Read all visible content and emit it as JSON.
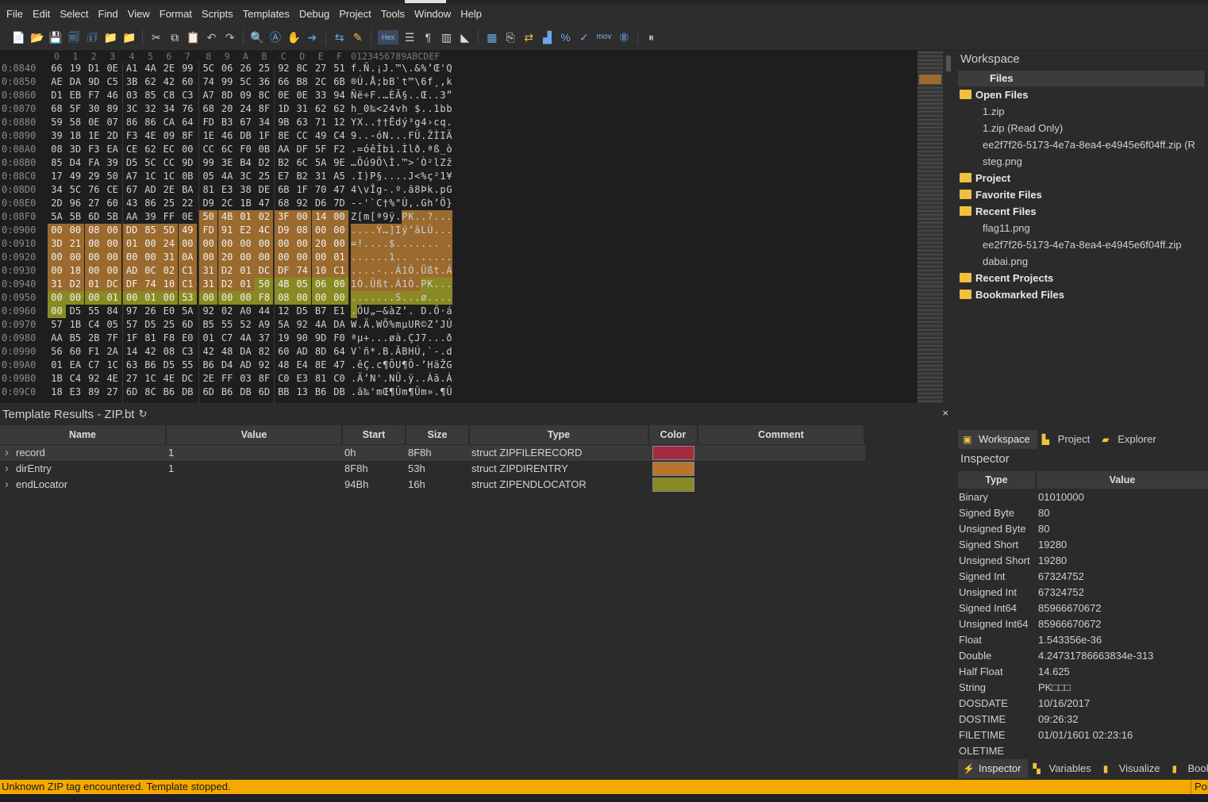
{
  "menu": [
    "File",
    "Edit",
    "Select",
    "Find",
    "View",
    "Format",
    "Scripts",
    "Templates",
    "Debug",
    "Project",
    "Tools",
    "Window",
    "Help"
  ],
  "toolbar": {
    "hex_label": "Hex",
    "mov_label": "mov"
  },
  "hex": {
    "col_headers": [
      "0",
      "1",
      "2",
      "3",
      "4",
      "5",
      "6",
      "7",
      "8",
      "9",
      "A",
      "B",
      "C",
      "D",
      "E",
      "F"
    ],
    "text_header": "0123456789ABCDEF",
    "rows": [
      {
        "addr": "0:0840",
        "bytes": [
          "66",
          "19",
          "D1",
          "0E",
          "A1",
          "4A",
          "2E",
          "99",
          "5C",
          "06",
          "26",
          "25",
          "92",
          "8C",
          "27",
          "51"
        ],
        "text": "f.Ñ.¡J.™\\.&%’Œ'Q"
      },
      {
        "addr": "0:0850",
        "bytes": [
          "AE",
          "DA",
          "9D",
          "C5",
          "3B",
          "62",
          "42",
          "60",
          "74",
          "99",
          "5C",
          "36",
          "66",
          "B8",
          "2C",
          "6B"
        ],
        "text": "®Ú.Å;bB`t™\\6f¸,k"
      },
      {
        "addr": "0:0860",
        "bytes": [
          "D1",
          "EB",
          "F7",
          "46",
          "03",
          "85",
          "C8",
          "C3",
          "A7",
          "8D",
          "09",
          "8C",
          "0E",
          "0E",
          "33",
          "94"
        ],
        "text": "Ñë÷F.…ÈÃ§..Œ..3”"
      },
      {
        "addr": "0:0870",
        "bytes": [
          "68",
          "5F",
          "30",
          "89",
          "3C",
          "32",
          "34",
          "76",
          "68",
          "20",
          "24",
          "8F",
          "1D",
          "31",
          "62",
          "62"
        ],
        "text": "h_0‰<24vh $..1bb"
      },
      {
        "addr": "0:0880",
        "bytes": [
          "59",
          "58",
          "0E",
          "07",
          "86",
          "86",
          "CA",
          "64",
          "FD",
          "B3",
          "67",
          "34",
          "9B",
          "63",
          "71",
          "12"
        ],
        "text": "YX..††Êdý³g4›cq."
      },
      {
        "addr": "0:0890",
        "bytes": [
          "39",
          "18",
          "1E",
          "2D",
          "F3",
          "4E",
          "09",
          "8F",
          "1E",
          "46",
          "DB",
          "1F",
          "8E",
          "CC",
          "49",
          "C4"
        ],
        "text": "9..-óN...FÛ.ŽÌIÄ"
      },
      {
        "addr": "0:08A0",
        "bytes": [
          "08",
          "3D",
          "F3",
          "EA",
          "CE",
          "62",
          "EC",
          "00",
          "CC",
          "6C",
          "F0",
          "0B",
          "AA",
          "DF",
          "5F",
          "F2"
        ],
        "text": ".=óêÎbì.Ìlð.ªß_ò"
      },
      {
        "addr": "0:08B0",
        "bytes": [
          "85",
          "D4",
          "FA",
          "39",
          "D5",
          "5C",
          "CC",
          "9D",
          "99",
          "3E",
          "B4",
          "D2",
          "B2",
          "6C",
          "5A",
          "9E"
        ],
        "text": "…Ôú9Õ\\Ì.™>´Ò²lZž"
      },
      {
        "addr": "0:08C0",
        "bytes": [
          "17",
          "49",
          "29",
          "50",
          "A7",
          "1C",
          "1C",
          "0B",
          "05",
          "4A",
          "3C",
          "25",
          "E7",
          "B2",
          "31",
          "A5"
        ],
        "text": ".I)P§....J<%ç²1¥"
      },
      {
        "addr": "0:08D0",
        "bytes": [
          "34",
          "5C",
          "76",
          "CE",
          "67",
          "AD",
          "2E",
          "BA",
          "81",
          "E3",
          "38",
          "DE",
          "6B",
          "1F",
          "70",
          "47"
        ],
        "text": "4\\vÎg-.º.ã8Þk.pG"
      },
      {
        "addr": "0:08E0",
        "bytes": [
          "2D",
          "96",
          "27",
          "60",
          "43",
          "86",
          "25",
          "22",
          "D9",
          "2C",
          "1B",
          "47",
          "68",
          "92",
          "D6",
          "7D"
        ],
        "text": "--'`C†%\"Ù,.Gh’Ö}"
      },
      {
        "addr": "0:08F0",
        "bytes": [
          "5A",
          "5B",
          "6D",
          "5B",
          "AA",
          "39",
          "FF",
          "0E",
          "50",
          "4B",
          "01",
          "02",
          "3F",
          "00",
          "14",
          "00"
        ],
        "text": "Z[m[ª9ÿ.PK..?..."
      },
      {
        "addr": "0:0900",
        "bytes": [
          "00",
          "00",
          "08",
          "00",
          "DD",
          "85",
          "5D",
          "49",
          "FD",
          "91",
          "E2",
          "4C",
          "D9",
          "08",
          "00",
          "00"
        ],
        "text": "....Ý…]Iý‘âLÙ..."
      },
      {
        "addr": "0:0910",
        "bytes": [
          "3D",
          "21",
          "00",
          "00",
          "01",
          "00",
          "24",
          "00",
          "00",
          "00",
          "00",
          "00",
          "00",
          "00",
          "20",
          "00"
        ],
        "text": "=!....$....... ."
      },
      {
        "addr": "0:0920",
        "bytes": [
          "00",
          "00",
          "00",
          "00",
          "00",
          "00",
          "31",
          "0A",
          "00",
          "20",
          "00",
          "00",
          "00",
          "00",
          "00",
          "01"
        ],
        "text": "......1.. ......"
      },
      {
        "addr": "0:0930",
        "bytes": [
          "00",
          "18",
          "00",
          "00",
          "AD",
          "0C",
          "02",
          "C1",
          "31",
          "D2",
          "01",
          "DC",
          "DF",
          "74",
          "10",
          "C1"
        ],
        "text": "....-..Á1Ò.Üßt.Á"
      },
      {
        "addr": "0:0940",
        "bytes": [
          "31",
          "D2",
          "01",
          "DC",
          "DF",
          "74",
          "10",
          "C1",
          "31",
          "D2",
          "01",
          "50",
          "4B",
          "05",
          "06",
          "00"
        ],
        "text": "1Ò.Üßt.Á1Ò.PK..."
      },
      {
        "addr": "0:0950",
        "bytes": [
          "00",
          "00",
          "00",
          "01",
          "00",
          "01",
          "00",
          "53",
          "00",
          "00",
          "00",
          "F8",
          "08",
          "00",
          "00",
          "00"
        ],
        "text": ".......S...ø...."
      },
      {
        "addr": "0:0960",
        "bytes": [
          "00",
          "D5",
          "55",
          "84",
          "97",
          "26",
          "E0",
          "5A",
          "92",
          "02",
          "A0",
          "44",
          "12",
          "D5",
          "B7",
          "E1"
        ],
        "text": ".ÕU„—&àZ’. D.Õ·á"
      },
      {
        "addr": "0:0970",
        "bytes": [
          "57",
          "1B",
          "C4",
          "05",
          "57",
          "D5",
          "25",
          "6D",
          "B5",
          "55",
          "52",
          "A9",
          "5A",
          "92",
          "4A",
          "DA"
        ],
        "text": "W.Ä.WÕ%mµUR©Z’JÚ"
      },
      {
        "addr": "0:0980",
        "bytes": [
          "AA",
          "B5",
          "2B",
          "7F",
          "1F",
          "81",
          "F8",
          "E0",
          "01",
          "C7",
          "4A",
          "37",
          "19",
          "90",
          "9D",
          "F0"
        ],
        "text": "ªµ+...øà.ÇJ7...ð"
      },
      {
        "addr": "0:0990",
        "bytes": [
          "56",
          "60",
          "F1",
          "2A",
          "14",
          "42",
          "08",
          "C3",
          "42",
          "48",
          "DA",
          "82",
          "60",
          "AD",
          "8D",
          "64"
        ],
        "text": "V`ñ*.B.ÃBHÚ‚`-.d"
      },
      {
        "addr": "0:09A0",
        "bytes": [
          "01",
          "EA",
          "C7",
          "1C",
          "63",
          "B6",
          "D5",
          "55",
          "B6",
          "D4",
          "AD",
          "92",
          "48",
          "E4",
          "8E",
          "47"
        ],
        "text": ".êÇ.c¶ÕU¶Ô-’HäŽG"
      },
      {
        "addr": "0:09B0",
        "bytes": [
          "1B",
          "C4",
          "92",
          "4E",
          "27",
          "1C",
          "4E",
          "DC",
          "2E",
          "FF",
          "03",
          "8F",
          "C0",
          "E3",
          "81",
          "C0"
        ],
        "text": ".Ä’N'.NÜ.ÿ..Àã.À"
      },
      {
        "addr": "0:09C0",
        "bytes": [
          "18",
          "E3",
          "89",
          "27",
          "6D",
          "8C",
          "B6",
          "DB",
          "6D",
          "B6",
          "DB",
          "6D",
          "BB",
          "13",
          "B6",
          "DB"
        ],
        "text": ".ã‰'mŒ¶Ûm¶Ûm».¶Û"
      }
    ]
  },
  "workspace": {
    "title": "Workspace",
    "files_header": "Files",
    "items": [
      {
        "kind": "folder",
        "label": "Open Files"
      },
      {
        "kind": "file",
        "label": "1.zip"
      },
      {
        "kind": "file",
        "label": "1.zip (Read Only)"
      },
      {
        "kind": "file",
        "label": "ee2f7f26-5173-4e7a-8ea4-e4945e6f04ff.zip (R"
      },
      {
        "kind": "file",
        "label": "steg.png"
      },
      {
        "kind": "folder",
        "label": "Project"
      },
      {
        "kind": "folder",
        "label": "Favorite Files"
      },
      {
        "kind": "folder",
        "label": "Recent Files"
      },
      {
        "kind": "file",
        "label": "flag11.png"
      },
      {
        "kind": "file",
        "label": "ee2f7f26-5173-4e7a-8ea4-e4945e6f04ff.zip"
      },
      {
        "kind": "file",
        "label": "dabai.png"
      },
      {
        "kind": "folder",
        "label": "Recent Projects"
      },
      {
        "kind": "folder",
        "label": "Bookmarked Files"
      }
    ]
  },
  "template": {
    "title": "Template Results - ZIP.bt",
    "refresh_glyph": "↻",
    "close_glyph": "×",
    "columns": [
      "Name",
      "Value",
      "Start",
      "Size",
      "Type",
      "Color",
      "Comment"
    ],
    "rows": [
      {
        "name": "record",
        "value": "1",
        "start": "0h",
        "size": "8F8h",
        "type": "struct ZIPFILERECORD",
        "color": "#a42a40"
      },
      {
        "name": "dirEntry",
        "value": "1",
        "start": "8F8h",
        "size": "53h",
        "type": "struct ZIPDIRENTRY",
        "color": "#b8742c"
      },
      {
        "name": "endLocator",
        "value": "",
        "start": "94Bh",
        "size": "16h",
        "type": "struct ZIPENDLOCATOR",
        "color": "#8a8a24"
      }
    ]
  },
  "side_tabs": [
    {
      "label": "Workspace",
      "icon": "workspace-icon",
      "glyph": "▣"
    },
    {
      "label": "Project",
      "icon": "project-icon",
      "glyph": "▙"
    },
    {
      "label": "Explorer",
      "icon": "folder-icon",
      "glyph": "▰"
    }
  ],
  "inspector": {
    "title": "Inspector",
    "columns": [
      "Type",
      "Value"
    ],
    "rows": [
      {
        "k": "Binary",
        "v": "01010000"
      },
      {
        "k": "Signed Byte",
        "v": "80"
      },
      {
        "k": "Unsigned Byte",
        "v": "80"
      },
      {
        "k": "Signed Short",
        "v": "19280"
      },
      {
        "k": "Unsigned Short",
        "v": "19280"
      },
      {
        "k": "Signed Int",
        "v": "67324752"
      },
      {
        "k": "Unsigned Int",
        "v": "67324752"
      },
      {
        "k": "Signed Int64",
        "v": "85966670672"
      },
      {
        "k": "Unsigned Int64",
        "v": "85966670672"
      },
      {
        "k": "Float",
        "v": "1.543356e-36"
      },
      {
        "k": "Double",
        "v": "4.24731786663834e-313"
      },
      {
        "k": "Half Float",
        "v": "14.625"
      },
      {
        "k": "String",
        "v": "PK□□□"
      },
      {
        "k": "DOSDATE",
        "v": "10/16/2017"
      },
      {
        "k": "DOSTIME",
        "v": "09:26:32"
      },
      {
        "k": "FILETIME",
        "v": "01/01/1601 02:23:16"
      },
      {
        "k": "OLETIME",
        "v": ""
      }
    ]
  },
  "bottom_tabs": [
    {
      "label": "Inspector",
      "icon": "lightning-icon",
      "glyph": "⚡"
    },
    {
      "label": "Variables",
      "icon": "variables-icon",
      "glyph": "▚"
    },
    {
      "label": "Visualize",
      "icon": "visualize-icon",
      "glyph": "▮"
    },
    {
      "label": "Book",
      "icon": "bookmark-icon",
      "glyph": "▮"
    }
  ],
  "status": {
    "message": "Unknown ZIP tag encountered. Template stopped.",
    "pos": "Pos"
  },
  "colors": {
    "dirEntry_hl": "#9b6a2e",
    "endLocator_hl": "#8a8a24"
  }
}
